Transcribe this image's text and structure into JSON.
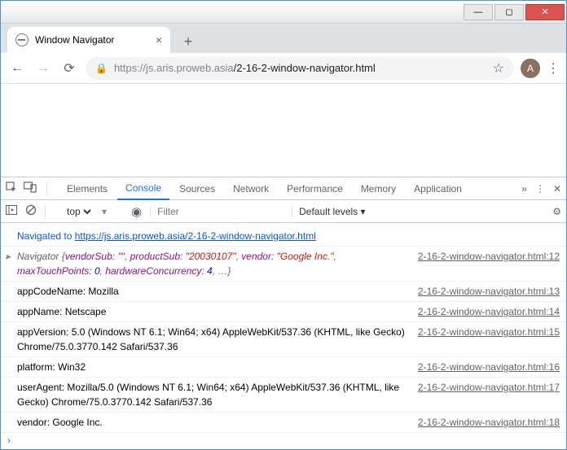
{
  "window": {
    "title": "Window Navigator"
  },
  "browser": {
    "tab_title": "Window Navigator",
    "url_host": "https://js.aris.proweb.asia",
    "url_path": "/2-16-2-window-navigator.html",
    "avatar_letter": "A"
  },
  "devtools": {
    "tabs": [
      "Elements",
      "Console",
      "Sources",
      "Network",
      "Performance",
      "Memory",
      "Application"
    ],
    "active_tab": "Console",
    "context": "top",
    "filter_placeholder": "Filter",
    "levels_label": "Default levels ▾"
  },
  "console": {
    "nav_prefix": "Navigated to ",
    "nav_url": "https://js.aris.proweb.asia/2-16-2-window-navigator.html",
    "obj_src": "2-16-2-window-navigator.html:12",
    "obj_name": "Navigator ",
    "obj_p1k": "vendorSub: ",
    "obj_p1v": "\"\"",
    "obj_p2k": "productSub: ",
    "obj_p2v": "\"20030107\"",
    "obj_p3k": "vendor: ",
    "obj_p3v": "\"Google Inc.\"",
    "obj_p4k": "maxTouchPoints: ",
    "obj_p4v": "0",
    "obj_p5k": "hardwareConcurrency: ",
    "obj_p5v": "4",
    "obj_tail": ", …}",
    "lines": [
      {
        "text": "appCodeName: Mozilla",
        "src": "2-16-2-window-navigator.html:13"
      },
      {
        "text": "appName: Netscape",
        "src": "2-16-2-window-navigator.html:14"
      },
      {
        "text": "appVersion: 5.0 (Windows NT 6.1; Win64; x64) AppleWebKit/537.36 (KHTML, like Gecko) Chrome/75.0.3770.142 Safari/537.36",
        "src": "2-16-2-window-navigator.html:15"
      },
      {
        "text": "platform: Win32",
        "src": "2-16-2-window-navigator.html:16"
      },
      {
        "text": "userAgent: Mozilla/5.0 (Windows NT 6.1; Win64; x64) AppleWebKit/537.36 (KHTML, like Gecko) Chrome/75.0.3770.142 Safari/537.36",
        "src": "2-16-2-window-navigator.html:17"
      },
      {
        "text": "vendor: Google Inc.",
        "src": "2-16-2-window-navigator.html:18"
      }
    ]
  }
}
